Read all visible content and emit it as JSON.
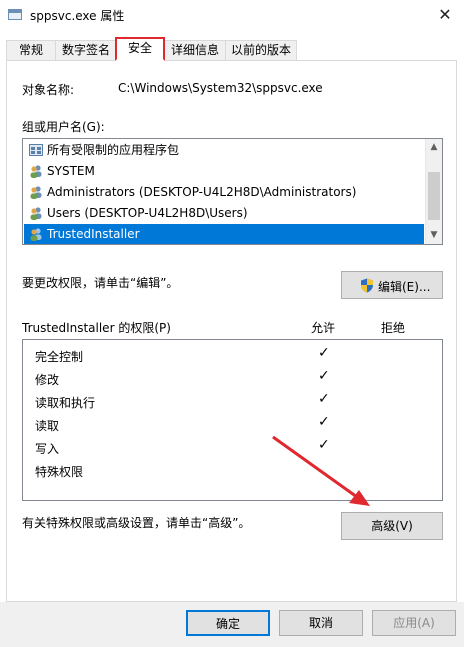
{
  "window": {
    "title": "sppsvc.exe 属性",
    "close_glyph": "✕"
  },
  "tabs": [
    {
      "label": "常规",
      "active": false
    },
    {
      "label": "数字签名",
      "active": false
    },
    {
      "label": "安全",
      "active": true
    },
    {
      "label": "详细信息",
      "active": false
    },
    {
      "label": "以前的版本",
      "active": false
    }
  ],
  "security": {
    "object_name_label": "对象名称:",
    "object_name_value": "C:\\Windows\\System32\\sppsvc.exe",
    "groups_label": "组或用户名(G):",
    "groups": [
      {
        "name": "所有受限制的应用程序包",
        "icon": "app-package-icon",
        "selected": false
      },
      {
        "name": "SYSTEM",
        "icon": "users-icon",
        "selected": false
      },
      {
        "name": "Administrators (DESKTOP-U4L2H8D\\Administrators)",
        "icon": "users-icon",
        "selected": false
      },
      {
        "name": "Users (DESKTOP-U4L2H8D\\Users)",
        "icon": "users-icon",
        "selected": false
      },
      {
        "name": "TrustedInstaller",
        "icon": "users-icon",
        "selected": true
      }
    ],
    "change_perm_text": "要更改权限，请单击“编辑”。",
    "edit_button": "编辑(E)...",
    "perm_for_label": "TrustedInstaller 的权限(P)",
    "allow_header": "允许",
    "deny_header": "拒绝",
    "permissions": [
      {
        "name": "完全控制",
        "allow": "✓"
      },
      {
        "name": "修改",
        "allow": "✓"
      },
      {
        "name": "读取和执行",
        "allow": "✓"
      },
      {
        "name": "读取",
        "allow": "✓"
      },
      {
        "name": "写入",
        "allow": "✓"
      },
      {
        "name": "特殊权限",
        "allow": ""
      }
    ],
    "advanced_text": "有关特殊权限或高级设置，请单击“高级”。",
    "advanced_button": "高级(V)"
  },
  "footer": {
    "ok_button": "确定",
    "cancel_button": "取消",
    "apply_button": "应用(A)"
  },
  "colors": {
    "selection": "#0078d7",
    "highlight_box": "#e0282f",
    "arrow": "#e0282f"
  }
}
